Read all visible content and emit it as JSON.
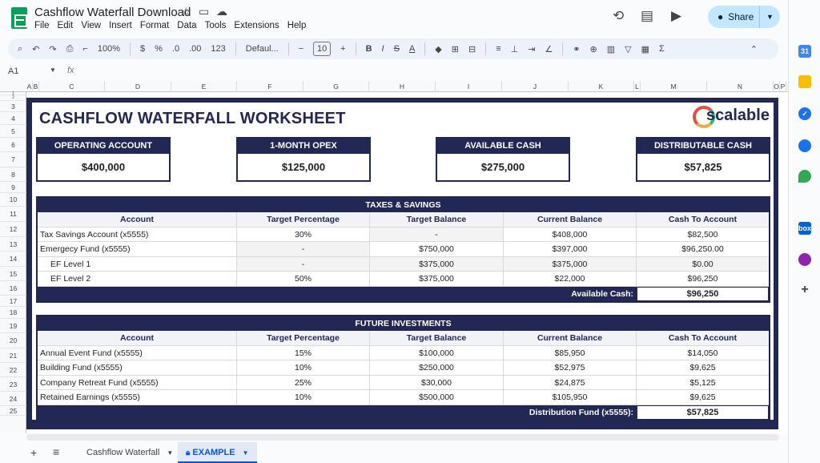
{
  "app": {
    "title": "Cashflow Waterfall Download",
    "menu": [
      "File",
      "Edit",
      "View",
      "Insert",
      "Format",
      "Data",
      "Tools",
      "Extensions",
      "Help"
    ],
    "share_label": "Share"
  },
  "toolbar": {
    "zoom": "100%",
    "currency": "$",
    "percent": "%",
    "dec_decrease": ".0",
    "dec_increase": ".00",
    "number_format": "123",
    "font": "Defaul...",
    "font_size": "10"
  },
  "formula_bar": {
    "cell_ref": "A1",
    "fx": "fx"
  },
  "columns": [
    "A",
    "B",
    "C",
    "D",
    "E",
    "F",
    "G",
    "H",
    "I",
    "J",
    "K",
    "L",
    "M",
    "N",
    "O",
    "P"
  ],
  "rows": [
    "1",
    "2",
    "3",
    "4",
    "5",
    "6",
    "7",
    "8",
    "9",
    "10",
    "11",
    "12",
    "13",
    "14",
    "15",
    "16",
    "17",
    "18",
    "19",
    "20",
    "21",
    "22",
    "23",
    "24",
    "25"
  ],
  "worksheet": {
    "title": "CASHFLOW WATERFALL WORKSHEET",
    "logo_text": "scalable",
    "kpis": [
      {
        "label": "OPERATING ACCOUNT",
        "value": "$400,000"
      },
      {
        "label": "1-MONTH OPEX",
        "value": "$125,000"
      },
      {
        "label": "AVAILABLE CASH",
        "value": "$275,000"
      },
      {
        "label": "DISTRIBUTABLE CASH",
        "value": "$57,825"
      }
    ],
    "headers": {
      "account": "Account",
      "target_pct": "Target Percentage",
      "target_bal": "Target Balance",
      "current_bal": "Current Balance",
      "cash_to_account": "Cash To Account"
    },
    "taxes_savings": {
      "title": "TAXES & SAVINGS",
      "rows": [
        {
          "account": "Tax Savings Account (x5555)",
          "pct": "30%",
          "target": "-",
          "current": "$408,000",
          "cash": "$82,500"
        },
        {
          "account": "Emergecy Fund (x5555)",
          "pct": "-",
          "target": "$750,000",
          "current": "$397,000",
          "cash": "$96,250.00"
        },
        {
          "account": "EF Level 1",
          "pct": "-",
          "target": "$375,000",
          "current": "$375,000",
          "cash": "$0.00"
        },
        {
          "account": "EF Level 2",
          "pct": "50%",
          "target": "$375,000",
          "current": "$22,000",
          "cash": "$96,250"
        }
      ],
      "footer_label": "Available Cash:",
      "footer_value": "$96,250"
    },
    "future_investments": {
      "title": "FUTURE INVESTMENTS",
      "rows": [
        {
          "account": "Annual Event Fund (x5555)",
          "pct": "15%",
          "target": "$100,000",
          "current": "$85,950",
          "cash": "$14,050"
        },
        {
          "account": "Building Fund (x5555)",
          "pct": "10%",
          "target": "$250,000",
          "current": "$52,975",
          "cash": "$9,625"
        },
        {
          "account": "Company Retreat Fund (x5555)",
          "pct": "25%",
          "target": "$30,000",
          "current": "$24,875",
          "cash": "$5,125"
        },
        {
          "account": "Retained Earnings (x5555)",
          "pct": "10%",
          "target": "$500,000",
          "current": "$105,950",
          "cash": "$9,625"
        }
      ],
      "footer_label": "Distribution Fund (x5555):",
      "footer_value": "$57,825"
    }
  },
  "sheet_tabs": [
    {
      "label": "Cashflow Waterfall"
    },
    {
      "label": "EXAMPLE"
    }
  ]
}
